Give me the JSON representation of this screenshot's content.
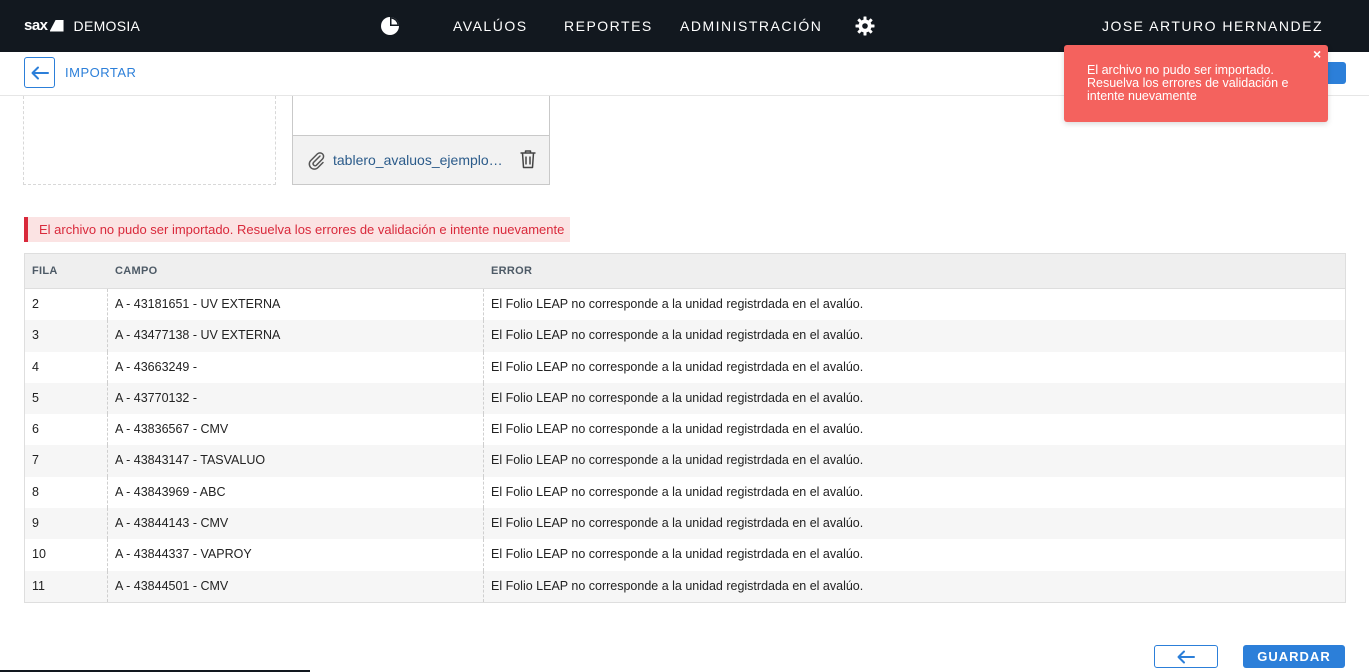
{
  "brand": {
    "logo_text": "sax",
    "name": "DEMOSIA"
  },
  "nav": {
    "items": [
      "AVALÚOS",
      "REPORTES",
      "ADMINISTRACIÓN"
    ],
    "user": "JOSE ARTURO HERNANDEZ",
    "icons": [
      "pie-chart-icon",
      "gear-icon"
    ]
  },
  "subheader": {
    "title": "IMPORTAR"
  },
  "upload": {
    "file_name": "tablero_avaluos_ejemplo.xlsx"
  },
  "error_banner": "El archivo no pudo ser importado. Resuelva los errores de validación e intente nuevamente",
  "table": {
    "headers": [
      "FILA",
      "CAMPO",
      "ERROR"
    ],
    "rows": [
      [
        "2",
        "A - 43181651 - UV EXTERNA",
        "El Folio LEAP no corresponde a la unidad registrdada en el avalúo."
      ],
      [
        "3",
        "A - 43477138 - UV EXTERNA",
        "El Folio LEAP no corresponde a la unidad registrdada en el avalúo."
      ],
      [
        "4",
        "A - 43663249 -",
        "El Folio LEAP no corresponde a la unidad registrdada en el avalúo."
      ],
      [
        "5",
        "A - 43770132 -",
        "El Folio LEAP no corresponde a la unidad registrdada en el avalúo."
      ],
      [
        "6",
        "A - 43836567 - CMV",
        "El Folio LEAP no corresponde a la unidad registrdada en el avalúo."
      ],
      [
        "7",
        "A - 43843147 - TASVALUO",
        "El Folio LEAP no corresponde a la unidad registrdada en el avalúo."
      ],
      [
        "8",
        "A - 43843969 - ABC",
        "El Folio LEAP no corresponde a la unidad registrdada en el avalúo."
      ],
      [
        "9",
        "A - 43844143 - CMV",
        "El Folio LEAP no corresponde a la unidad registrdada en el avalúo."
      ],
      [
        "10",
        "A - 43844337 - VAPROY",
        "El Folio LEAP no corresponde a la unidad registrdada en el avalúo."
      ],
      [
        "11",
        "A - 43844501 - CMV",
        "El Folio LEAP no corresponde a la unidad registrdada en el avalúo."
      ]
    ]
  },
  "buttons": {
    "save": "GUARDAR"
  },
  "toast": {
    "message": "El archivo no pudo ser importado. Resuelva los errores de validación e intente nuevamente",
    "close": "×"
  },
  "colors": {
    "topbar": "#12181f",
    "accent": "#2c7fd9",
    "error": "#d9293b",
    "error_bg": "#fbe3e3",
    "toast": "#f4625e"
  }
}
